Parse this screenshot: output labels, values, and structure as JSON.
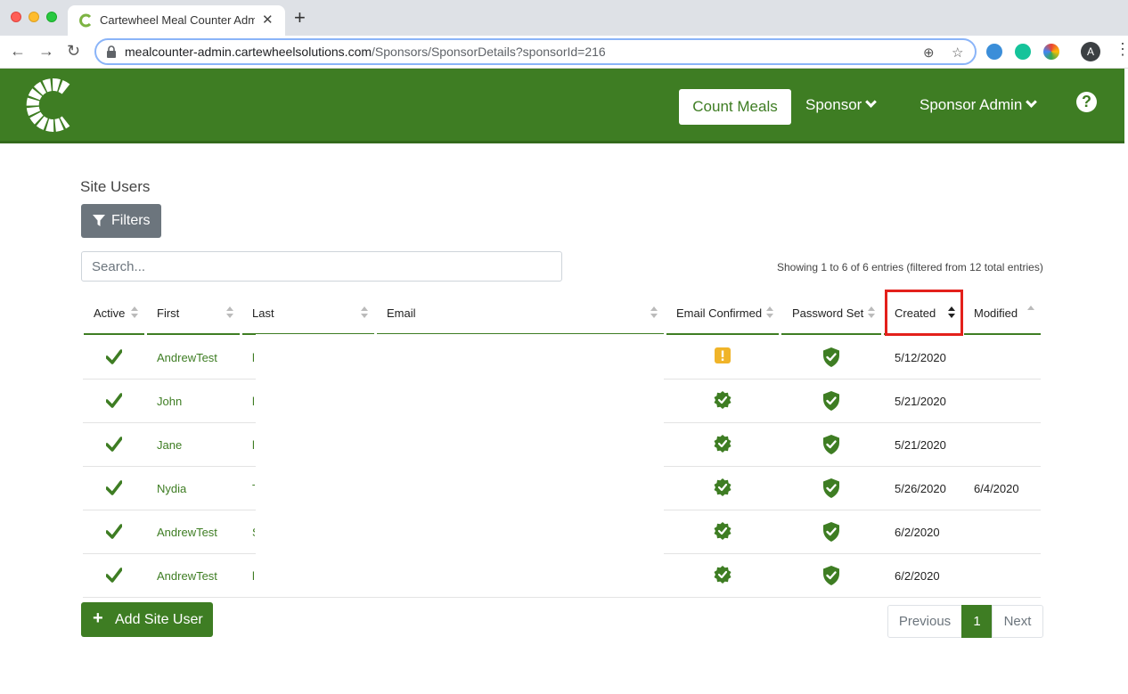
{
  "browser": {
    "tab_title": "Cartewheel Meal Counter Admin",
    "tab_close": "✕",
    "new_tab": "+",
    "url_host": "mealcounter-admin.cartewheelsolutions.com",
    "url_path": "/Sponsors/SponsorDetails?sponsorId=216",
    "profile_initial": "A"
  },
  "header": {
    "count_meals": "Count Meals",
    "sponsor": "Sponsor",
    "sponsor_admin": "Sponsor Admin",
    "help": "?",
    "brand_color": "#3e7d23"
  },
  "page": {
    "title": "Site Users",
    "filters_label": "Filters",
    "search_placeholder": "Search...",
    "info": "Showing 1 to 6 of 6 entries (filtered from 12 total entries)"
  },
  "table": {
    "columns": [
      "Active",
      "First",
      "Last",
      "Email",
      "Email Confirmed",
      "Password Set",
      "Created",
      "Modified"
    ],
    "rows": [
      {
        "first": "AndrewTest",
        "last": "l",
        "email_confirmed": "warning",
        "password_set": true,
        "created": "5/12/2020",
        "modified": ""
      },
      {
        "first": "John",
        "last": "l",
        "email_confirmed": "confirmed",
        "password_set": true,
        "created": "5/21/2020",
        "modified": ""
      },
      {
        "first": "Jane",
        "last": "l",
        "email_confirmed": "confirmed",
        "password_set": true,
        "created": "5/21/2020",
        "modified": ""
      },
      {
        "first": "Nydia",
        "last": "T",
        "email_confirmed": "confirmed",
        "password_set": true,
        "created": "5/26/2020",
        "modified": "6/4/2020"
      },
      {
        "first": "AndrewTest",
        "last": "S",
        "email_confirmed": "confirmed",
        "password_set": true,
        "created": "6/2/2020",
        "modified": ""
      },
      {
        "first": "AndrewTest",
        "last": "l",
        "email_confirmed": "confirmed",
        "password_set": true,
        "created": "6/2/2020",
        "modified": ""
      }
    ]
  },
  "footer": {
    "add_label": "Add Site User",
    "previous": "Previous",
    "page": "1",
    "next": "Next"
  }
}
